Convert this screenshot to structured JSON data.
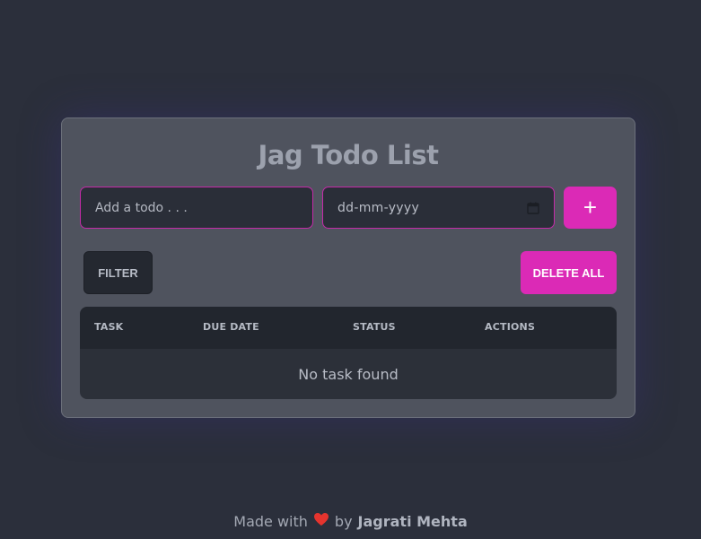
{
  "app": {
    "title": "Jag Todo List"
  },
  "form": {
    "todo_placeholder": "Add a todo . . .",
    "date_placeholder": "dd-mm-yyyy",
    "add_label": "+"
  },
  "toolbar": {
    "filter_label": "FILTER",
    "delete_all_label": "DELETE ALL"
  },
  "table": {
    "columns": [
      "TASK",
      "DUE DATE",
      "STATUS",
      "ACTIONS"
    ],
    "empty_message": "No task found"
  },
  "footer": {
    "made_with": "Made with",
    "by": "by",
    "author": "Jagrati Mehta"
  },
  "colors": {
    "background": "#2b2f3b",
    "card": "#4f535e",
    "accent": "#db2ab6",
    "heart": "#e5342e"
  },
  "icons": {
    "calendar": "calendar-icon",
    "heart": "heart-icon"
  }
}
